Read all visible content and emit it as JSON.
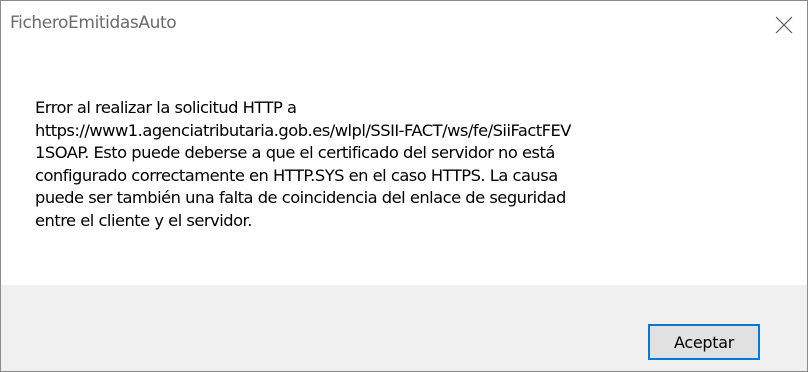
{
  "window": {
    "title": "FicheroEmitidasAuto"
  },
  "dialog": {
    "message": "Error al realizar la solicitud HTTP a\nhttps://www1.agenciatributaria.gob.es/wlpl/SSII-FACT/ws/fe/SiiFactFEV\n1SOAP. Esto puede deberse a que el certificado del servidor no está\nconfigurado correctamente en HTTP.SYS en el caso HTTPS. La causa\npuede ser también una falta de coincidencia del enlace de seguridad\nentre el cliente y el servidor.",
    "ok_label": "Aceptar"
  },
  "icons": {
    "close": "close-icon"
  },
  "colors": {
    "button_focus_border": "#0078d7",
    "footer_background": "#f0f0f0",
    "button_background": "#e1e1e1"
  }
}
